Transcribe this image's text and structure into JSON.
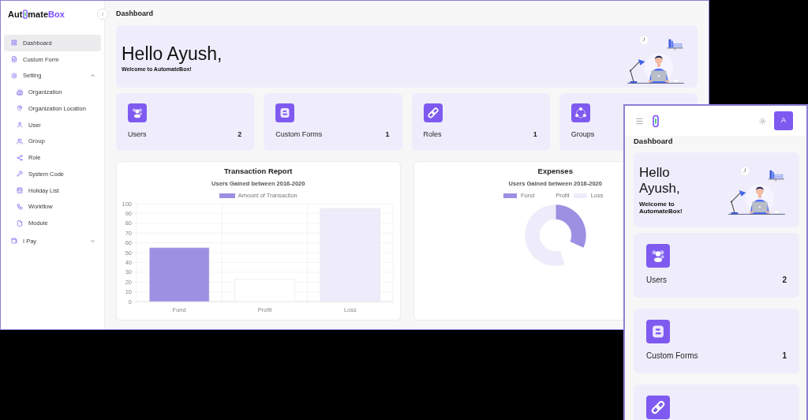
{
  "desktop": {
    "sidebar": {
      "logo": {
        "start": "Aut",
        "rest": "mate",
        "accent": "Box"
      },
      "items": [
        {
          "label": "Dashboard",
          "selected": true
        },
        {
          "label": "Custom Form",
          "selected": false
        },
        {
          "label": "Setting",
          "selected": false,
          "expanded": true,
          "children": [
            {
              "label": "Organization",
              "selected": false
            },
            {
              "label": "Organization Location",
              "selected": false
            },
            {
              "label": "User",
              "selected": false
            },
            {
              "label": "Group",
              "selected": false
            },
            {
              "label": "Role",
              "selected": false
            },
            {
              "label": "System Code",
              "selected": false
            },
            {
              "label": "Holiday List",
              "selected": false
            },
            {
              "label": "Workflow",
              "selected": false
            },
            {
              "label": "Module",
              "selected": false
            }
          ]
        },
        {
          "label": "I Pay",
          "selected": false,
          "expanded": false
        }
      ]
    },
    "page_title": "Dashboard",
    "hero": {
      "greeting": "Hello Ayush,",
      "subtitle": "Welcome to AutomateBox!"
    },
    "stat_cards": [
      {
        "label": "Users",
        "count": "2"
      },
      {
        "label": "Custom Forms",
        "count": "1"
      },
      {
        "label": "Roles",
        "count": "1"
      },
      {
        "label": "Groups"
      }
    ],
    "charts": [
      {
        "heading": "Transaction Report",
        "chart_data": {
          "type": "bar",
          "title": "Users Gained between 2016-2020",
          "categories": [
            "Fund",
            "Profit",
            "Loss"
          ],
          "series": [
            {
              "name": "Amount of Transaction",
              "color": "#9d8fe2",
              "colors": [
                "#9d8fe2",
                "#ffffff",
                "#eeebfa"
              ],
              "values": [
                55,
                23,
                95
              ]
            }
          ],
          "ylim": [
            0,
            100
          ],
          "yticks": [
            0,
            10,
            20,
            30,
            40,
            50,
            60,
            70,
            80,
            90,
            100
          ],
          "grid": true
        }
      },
      {
        "heading": "Expenses",
        "chart_data": {
          "type": "donut",
          "title": "Users Gained between 2016-2020",
          "categories": [
            "Fund",
            "Profit",
            "Loss"
          ],
          "values": [
            31.8,
            13.3,
            54.9
          ],
          "colors": [
            "#9d8fe2",
            "#ffffff",
            "#eeebfa"
          ]
        }
      }
    ]
  },
  "mobile": {
    "avatar": "A",
    "page_title": "Dashboard",
    "hero": {
      "greeting": "Hello Ayush,",
      "subtitle": "Welcome to AutomateBox!"
    },
    "stat_cards": [
      {
        "kind": "full",
        "label": "Users",
        "count": "2"
      },
      {
        "kind": "full",
        "label": "Custom Forms",
        "count": "1"
      },
      {
        "kind": "cut"
      }
    ]
  }
}
